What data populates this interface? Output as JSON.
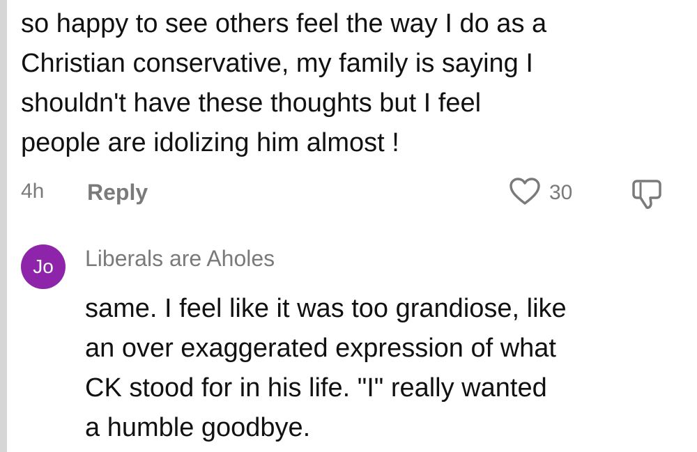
{
  "comment": {
    "text": "so happy to see others feel the way I do as a\nChristian conservative, my family is saying I\nshouldn't have these thoughts but I feel\npeople are idolizing him almost !",
    "time": "4h",
    "reply_label": "Reply",
    "like_count": "30"
  },
  "reply": {
    "avatar_initials": "Jo",
    "avatar_color": "#8e24aa",
    "username": "Liberals are Aholes",
    "text": "same. I feel like it was too grandiose, like\nan over exaggerated expression of what\nCK stood for in his life. \"I\" really wanted\na humble goodbye."
  },
  "colors": {
    "text": "#111111",
    "muted": "#7a7a7a"
  },
  "icons": {
    "like": "heart-outline-icon",
    "dislike": "thumbs-down-icon"
  }
}
